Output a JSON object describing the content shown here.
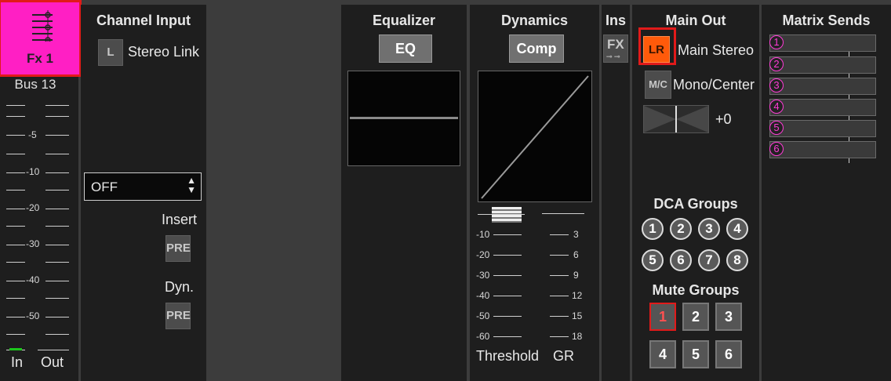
{
  "channel": {
    "name": "Fx 1",
    "bus_label": "Bus 13"
  },
  "colors": {
    "channel_accent": "#ff1fc4",
    "highlight_outline": "#e11a1a",
    "lr_active": "#ff5a0a",
    "matrix_accent": "#ff3ad6"
  },
  "meter": {
    "labels": [
      "-5",
      "-10",
      "-20",
      "-30",
      "-40",
      "-50"
    ],
    "in_label": "In",
    "out_label": "Out"
  },
  "channel_input": {
    "title": "Channel Input",
    "link_button": "L",
    "link_label": "Stereo Link",
    "source_select": "OFF",
    "insert_label": "Insert",
    "insert_button": "PRE",
    "dyn_label": "Dyn.",
    "dyn_button": "PRE"
  },
  "equalizer": {
    "title": "Equalizer",
    "button": "EQ"
  },
  "dynamics": {
    "title": "Dynamics",
    "button": "Comp",
    "threshold_ticks": [
      "-10",
      "-20",
      "-30",
      "-40",
      "-50",
      "-60"
    ],
    "gr_ticks": [
      "3",
      "6",
      "9",
      "12",
      "15",
      "18"
    ],
    "threshold_label": "Threshold",
    "gr_label": "GR"
  },
  "inserts": {
    "title": "Ins",
    "fx_button": "FX"
  },
  "main_out": {
    "title": "Main Out",
    "lr_button": "LR",
    "lr_label": "Main Stereo",
    "mc_button": "M/C",
    "mc_label": "Mono/Center",
    "pan_value": "+0",
    "dca_title": "DCA Groups",
    "dca": [
      "1",
      "2",
      "3",
      "4",
      "5",
      "6",
      "7",
      "8"
    ],
    "mute_title": "Mute Groups",
    "mute": [
      "1",
      "2",
      "3",
      "4",
      "5",
      "6"
    ]
  },
  "matrix": {
    "title": "Matrix Sends",
    "sends": [
      "1",
      "2",
      "3",
      "4",
      "5",
      "6"
    ]
  }
}
